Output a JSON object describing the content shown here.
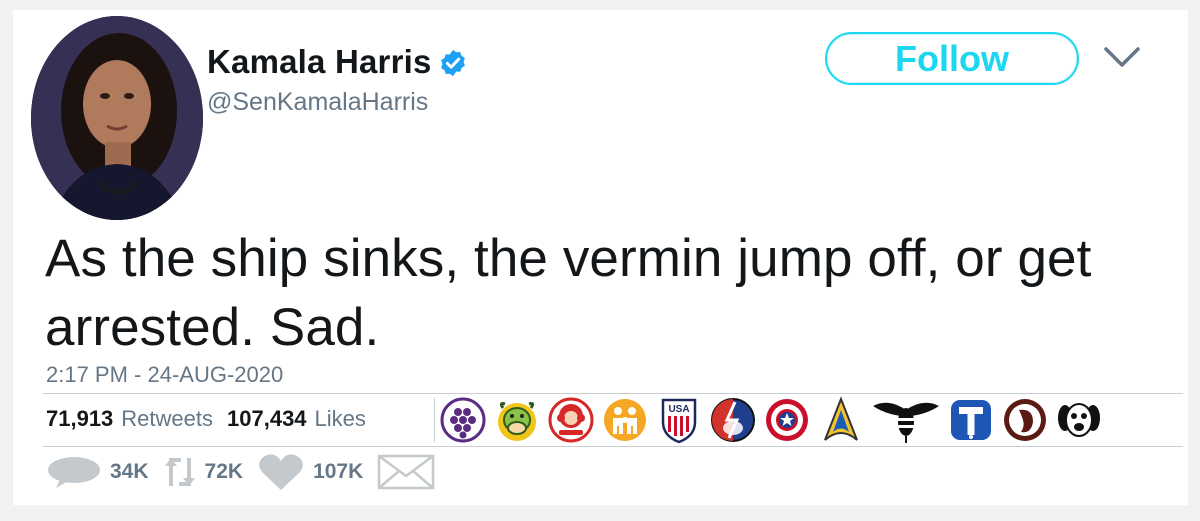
{
  "tweet": {
    "author": {
      "name": "Kamala Harris",
      "handle": "@SenKamalaHarris",
      "verified_icon": "verified-badge-icon"
    },
    "follow_label": "Follow",
    "text_line1": "As the ship sinks, the vermin jump off, or get",
    "text_line2": "arrested. Sad.",
    "timestamp": "2:17 PM - 24-AUG-2020",
    "stats": {
      "retweets": "71,913",
      "retweets_label": "Retweets",
      "likes": "107,434",
      "likes_label": "Likes"
    },
    "liker_badges": [
      "grapes-icon",
      "cow-icon",
      "wendys-icon",
      "family-icon",
      "usa-shield-icon",
      "steal-your-face-icon",
      "captain-america-shield-icon",
      "starfleet-icon",
      "bee-icon",
      "t-logo-icon",
      "chipotle-pepper-icon",
      "dog-face-icon"
    ],
    "actions": {
      "replies": "34K",
      "retweets": "72K",
      "likes": "107K"
    }
  },
  "colors": {
    "follow_accent": "#1dd6f0",
    "verified_blue": "#1da1f2",
    "secondary_text": "#657786",
    "primary_text": "#14171a"
  }
}
